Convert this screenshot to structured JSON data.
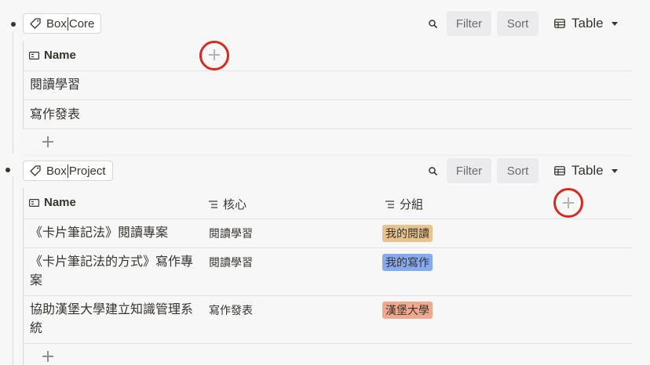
{
  "colors": {
    "highlight_ring": "#d9281c",
    "pill_reading": "#e7c38f",
    "pill_writing": "#86a9ef",
    "pill_castle": "#f0a88e"
  },
  "toolbar": {
    "filter_label": "Filter",
    "sort_label": "Sort",
    "view_label": "Table"
  },
  "sections": [
    {
      "tag_prefix": "Box",
      "tag_suffix": "Core",
      "columns": {
        "name": "Name"
      },
      "rows": [
        {
          "name": "閱讀學習"
        },
        {
          "name": "寫作發表"
        }
      ]
    },
    {
      "tag_prefix": "Box",
      "tag_suffix": "Project",
      "columns": {
        "name": "Name",
        "core": "核心",
        "group": "分組"
      },
      "rows": [
        {
          "name_line1": "《卡片筆記法》閱讀專案",
          "core": "閱讀學習",
          "group": "我的閱讀"
        },
        {
          "name_line1": "《卡片筆記法的方式》寫作專",
          "name_line2": "案",
          "core": "閱讀學習",
          "group": "我的寫作"
        },
        {
          "name_line1": "協助漢堡大學建立知識管理系",
          "name_line2": "統",
          "core": "寫作發表",
          "group": "漢堡大學"
        }
      ]
    }
  ]
}
